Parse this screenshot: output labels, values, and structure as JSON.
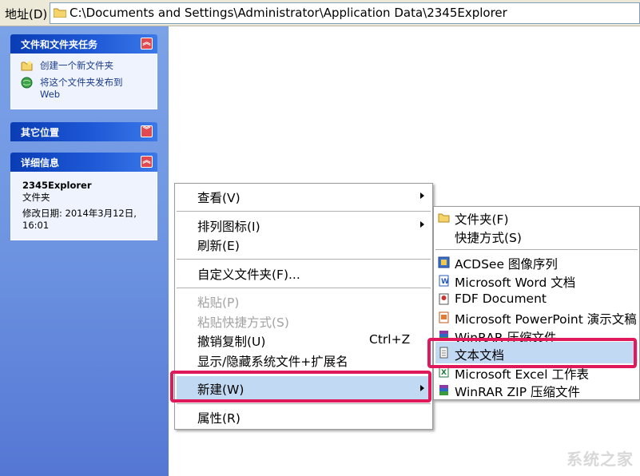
{
  "address_bar": {
    "label": "地址(D)",
    "path": "C:\\Documents and Settings\\Administrator\\Application Data\\2345Explorer"
  },
  "task_pane": {
    "file_tasks": {
      "title": "文件和文件夹任务",
      "items": [
        "创建一个新文件夹",
        "将这个文件夹发布到",
        "Web"
      ]
    },
    "other_places": {
      "title": "其它位置"
    },
    "details": {
      "title": "详细信息",
      "name": "2345Explorer",
      "type": "文件夹",
      "modified": "修改日期: 2014年3月12日,",
      "modified_time": "16:01"
    }
  },
  "context_menu": {
    "view": "查看(V)",
    "arrange": "排列图标(I)",
    "refresh": "刷新(E)",
    "customize": "自定义文件夹(F)...",
    "paste": "粘贴(P)",
    "paste_shortcut": "粘贴快捷方式(S)",
    "undo_copy": "撤销复制(U)",
    "undo_shortcut": "Ctrl+Z",
    "show_hide": "显示/隐藏系统文件+扩展名",
    "new": "新建(W)",
    "properties": "属性(R)"
  },
  "new_submenu": {
    "folder": "文件夹(F)",
    "shortcut": "快捷方式(S)",
    "acdsee": "ACDSee 图像序列",
    "word": "Microsoft Word 文档",
    "fdf": "FDF Document",
    "powerpoint": "Microsoft PowerPoint 演示文稿",
    "winrar": "WinRAR 压缩文件",
    "text": "文本文档",
    "excel": "Microsoft Excel 工作表",
    "winrar_zip": "WinRAR ZIP 压缩文件"
  },
  "watermark": "系统之家",
  "colors": {
    "highlight_border": "#e0195a",
    "menu_highlight": "#c1d9f3",
    "pane_header": "#0a3cb5"
  }
}
